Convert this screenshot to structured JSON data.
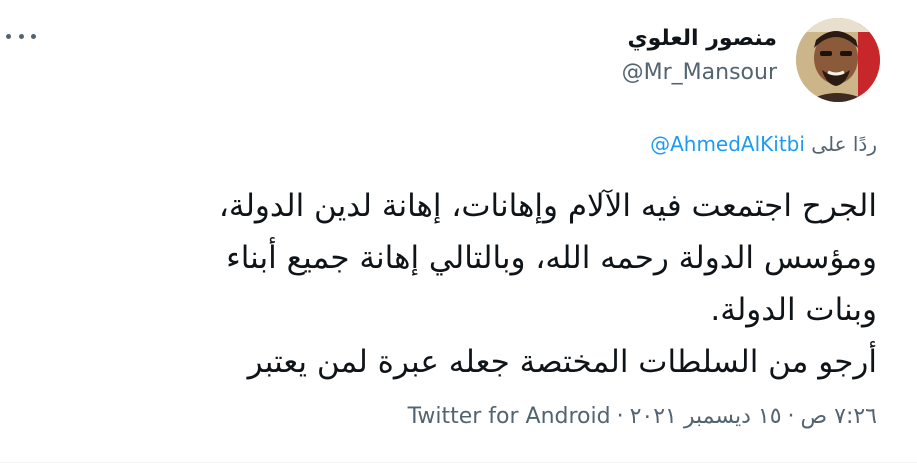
{
  "author": {
    "display_name": "منصور العلوي",
    "handle": "@Mr_Mansour"
  },
  "reply": {
    "prefix": "ردًا على",
    "mention": "@AhmedAlKitbi"
  },
  "tweet": {
    "lines": [
      "الجرح اجتمعت فيه الآلام وإهانات، إهانة لدين الدولة،",
      "ومؤسس الدولة رحمه الله، وبالتالي إهانة جميع أبناء",
      "وبنات الدولة.",
      "أرجو من السلطات المختصة جعله عبرة لمن يعتبر"
    ]
  },
  "meta": {
    "time": "٧:٢٦ ص",
    "date": "١٥ ديسمبر ٢٠٢١",
    "source": "Twitter for Android",
    "separator": "·"
  },
  "icons": {
    "more": "more-options-icon",
    "avatar": "profile-photo"
  },
  "colors": {
    "link": "#1d9bf0",
    "secondary_text": "#536471",
    "primary_text": "#0f1419"
  }
}
